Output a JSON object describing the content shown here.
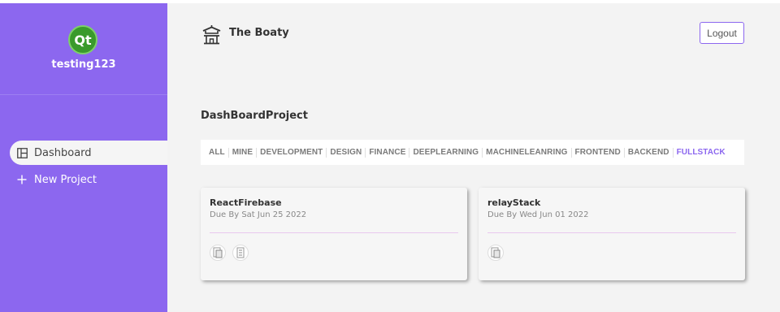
{
  "sidebar": {
    "logo_text": "Qt",
    "username": "testing123",
    "items": [
      {
        "label": "Dashboard",
        "icon": "layout-icon",
        "active": true
      },
      {
        "label": "New Project",
        "icon": "plus-icon",
        "active": false
      }
    ]
  },
  "header": {
    "app_name": "The Boaty",
    "logout_label": "Logout"
  },
  "main": {
    "section_title": "DashBoardProject",
    "tabs": [
      "ALL",
      "MINE",
      "DEVELOPMENT",
      "DESIGN",
      "FINANCE",
      "DEEPLEARNING",
      "MACHINELEANRING",
      "FRONTEND",
      "BACKEND",
      "FULLSTACK"
    ],
    "active_tab": "FULLSTACK",
    "projects": [
      {
        "name": "ReactFirebase",
        "due": "Due By Sat Jun 25 2022",
        "members": 2
      },
      {
        "name": "relayStack",
        "due": "Due By Wed Jun 01 2022",
        "members": 1
      }
    ]
  },
  "colors": {
    "accent": "#8c67ef",
    "background": "#f3f3f3"
  }
}
